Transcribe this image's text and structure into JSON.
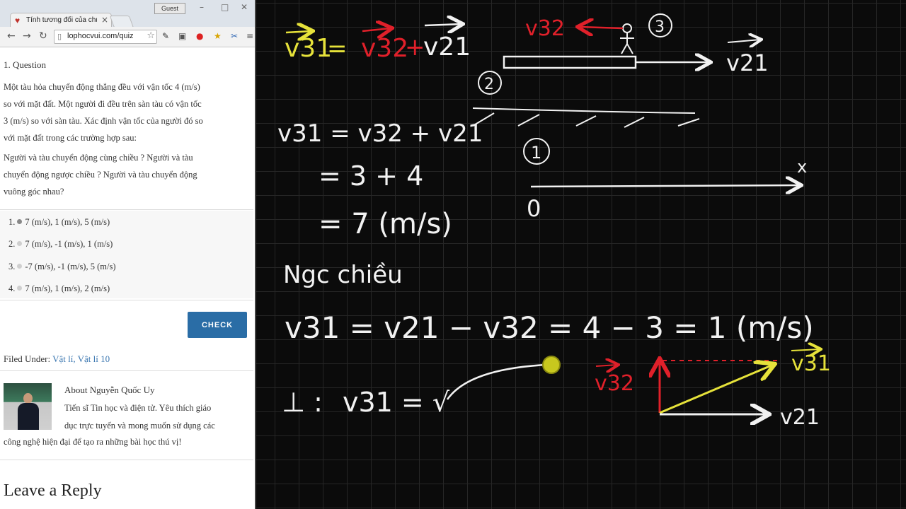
{
  "browser": {
    "tab_title": "Tính tương đối của chuyển",
    "tab_close": "×",
    "guest_label": "Guest",
    "url": "lophocvui.com/quiz",
    "icons": [
      "back-arrow-icon",
      "forward-arrow-icon",
      "reload-icon",
      "page-icon",
      "star-icon",
      "pipette-icon",
      "screen-icon",
      "opera-icon",
      "bookmark-icon",
      "tool-icon",
      "menu-icon"
    ]
  },
  "quiz": {
    "title": "1. Question",
    "text_lines": [
      "Một tàu hỏa chuyển động thẳng đều với vận tốc 4 (m/s)",
      "so với mặt đất. Một người đi đều trên sàn tàu có vận tốc",
      "3 (m/s) so với sàn tàu. Xác định vận tốc của người đó so",
      "với mặt đất trong các trường hợp sau:"
    ],
    "cases_lines": [
      "Người và tàu chuyển động cùng chiều ? Người và tàu",
      "chuyển động ngược chiều ? Người và tàu chuyển động",
      "vuông góc nhau?"
    ],
    "answers": [
      {
        "num": "1.",
        "label": "7 (m/s), 1 (m/s), 5 (m/s)"
      },
      {
        "num": "2.",
        "label": "7 (m/s), -1 (m/s), 1 (m/s)"
      },
      {
        "num": "3.",
        "label": "-7 (m/s), -1 (m/s), 5 (m/s)"
      },
      {
        "num": "4.",
        "label": "7 (m/s), 1 (m/s), 2 (m/s)"
      }
    ],
    "check_label": "CHECK"
  },
  "filed": {
    "prefix": "Filed Under:",
    "cat1": "Vật lí",
    "sep": ",",
    "cat2": "Vật lí 10"
  },
  "author": {
    "heading": "About Nguyễn Quốc Uy",
    "bio_lines": [
      "Tiến sĩ Tin học và điện tử. Yêu thích giáo",
      "dục trực tuyến và mong muốn sử dụng các",
      "công nghệ hiện đại để tạo ra những bài học thú vị!"
    ]
  },
  "comments": {
    "heading": "Leave a Reply"
  },
  "board": {
    "colors": {
      "yellow": "#e6e23a",
      "red": "#e0202a",
      "white": "#f2f2f2"
    },
    "eq_top_lhs": "v31",
    "eq_top_eq": "=",
    "eq_top_v32": "v32",
    "eq_top_plus": "+",
    "eq_top_v21": "v21",
    "label_v32": "v32",
    "label_v21": "v21",
    "circle_2": "2",
    "circle_3": "3",
    "circle_1": "1",
    "line1": "v31 = v32 + v21",
    "line2": "= 3 + 4",
    "line3": "= 7 (m/s)",
    "axis_x": "x",
    "axis_o": "0",
    "heading_opposite": "Ngc chiều",
    "line_opposite": "v31 = v21 − v32  = 4 − 3  = 1 (m/s)",
    "perp_prefix": "⊥ :",
    "perp_eq": "v31 = √",
    "tri_v32": "v32",
    "tri_v31": "v31",
    "tri_v21": "v21"
  }
}
